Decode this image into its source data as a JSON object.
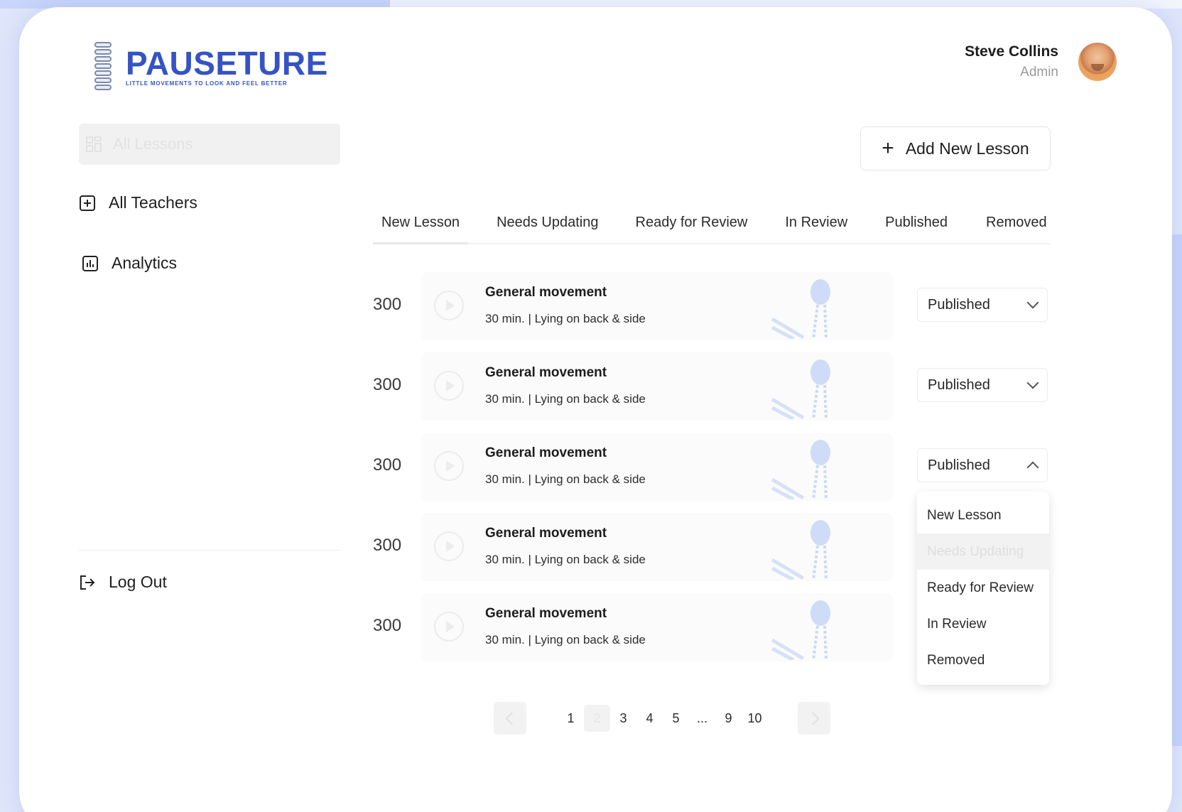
{
  "brand": {
    "name": "PAUSETURE",
    "tagline": "LITTLE MOVEMENTS TO LOOK AND FEEL BETTER"
  },
  "user": {
    "name": "Steve Collins",
    "role": "Admin"
  },
  "sidebar": {
    "items": [
      {
        "label": "All Lessons",
        "icon": "grid-icon"
      },
      {
        "label": "All Teachers",
        "icon": "plus-square-icon"
      },
      {
        "label": "Analytics",
        "icon": "chart-icon"
      }
    ],
    "logout_label": "Log Out"
  },
  "toolbar": {
    "add_label": "Add New Lesson"
  },
  "tabs": [
    "New Lesson",
    "Needs Updating",
    "Ready for Review",
    "In Review",
    "Published",
    "Removed"
  ],
  "lessons": [
    {
      "number": "300",
      "title": "General movement",
      "meta": "30 min. | Lying on back & side",
      "status": "Published"
    },
    {
      "number": "300",
      "title": "General movement",
      "meta": "30 min. | Lying on back & side",
      "status": "Published"
    },
    {
      "number": "300",
      "title": "General movement",
      "meta": "30 min. | Lying on back & side",
      "status": "Published"
    },
    {
      "number": "300",
      "title": "General movement",
      "meta": "30 min. | Lying on back & side",
      "status": ""
    },
    {
      "number": "300",
      "title": "General movement",
      "meta": "30 min. | Lying on back & side",
      "status": ""
    }
  ],
  "status_menu": {
    "options": [
      "New Lesson",
      "Needs Updating",
      "Ready for Review",
      "In Review",
      "Removed"
    ],
    "highlighted": "Needs Updating"
  },
  "pagination": {
    "pages": [
      "1",
      "2",
      "3",
      "4",
      "5",
      "...",
      "9",
      "10"
    ],
    "current": "2"
  },
  "colors": {
    "brand": "#3553c4",
    "background": "#dfe6fb",
    "figure": "#a9c3f5"
  }
}
